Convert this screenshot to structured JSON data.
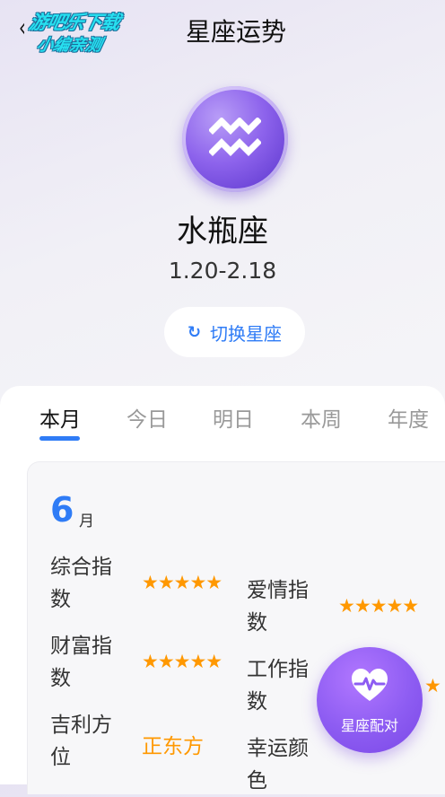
{
  "header": {
    "watermark_line1": "游吧乐下载",
    "watermark_line2": "小编亲测",
    "back_glyph": "‹",
    "title": "星座运势"
  },
  "sign": {
    "icon": "aquarius-icon",
    "name": "水瓶座",
    "dates": "1.20-2.18",
    "switch_label": "切换星座",
    "switch_icon": "refresh-icon"
  },
  "tabs": [
    {
      "label": "本月",
      "active": true
    },
    {
      "label": "今日",
      "active": false
    },
    {
      "label": "明日",
      "active": false
    },
    {
      "label": "本周",
      "active": false
    },
    {
      "label": "年度",
      "active": false
    }
  ],
  "card": {
    "month_number": "6",
    "month_unit": "月",
    "items": [
      {
        "label": "综合指数",
        "value_type": "stars",
        "stars": 5,
        "star_glyphs": "★★★★★"
      },
      {
        "label": "爱情指数",
        "value_type": "stars",
        "stars": 5,
        "star_glyphs": "★★★★★"
      },
      {
        "label": "财富指数",
        "value_type": "stars",
        "stars": 5,
        "star_glyphs": "★★★★★"
      },
      {
        "label": "工作指数",
        "value_type": "stars",
        "stars": 5,
        "star_glyphs": "★"
      },
      {
        "label": "吉利方位",
        "value_type": "text",
        "value": "正东方"
      },
      {
        "label": "幸运颜色",
        "value_type": "text",
        "value": ""
      }
    ]
  },
  "fab": {
    "icon": "heart-pulse-icon",
    "label": "星座配对"
  },
  "colors": {
    "accent": "#2f7cf6",
    "star": "#ff9800",
    "fab_purple": "#8d5cf2"
  }
}
